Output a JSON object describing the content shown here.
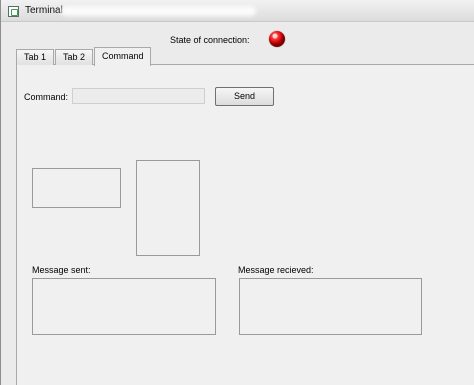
{
  "window": {
    "title": "Terminal"
  },
  "connection": {
    "label": "State of connection:",
    "status_color": "#e00000"
  },
  "tabs": [
    {
      "label": "Tab 1"
    },
    {
      "label": "Tab 2"
    },
    {
      "label": "Command",
      "active": true
    }
  ],
  "command": {
    "label": "Command:",
    "value": "",
    "send_label": "Send"
  },
  "messages": {
    "sent_label": "Message sent:",
    "received_label": "Message recieved:"
  }
}
